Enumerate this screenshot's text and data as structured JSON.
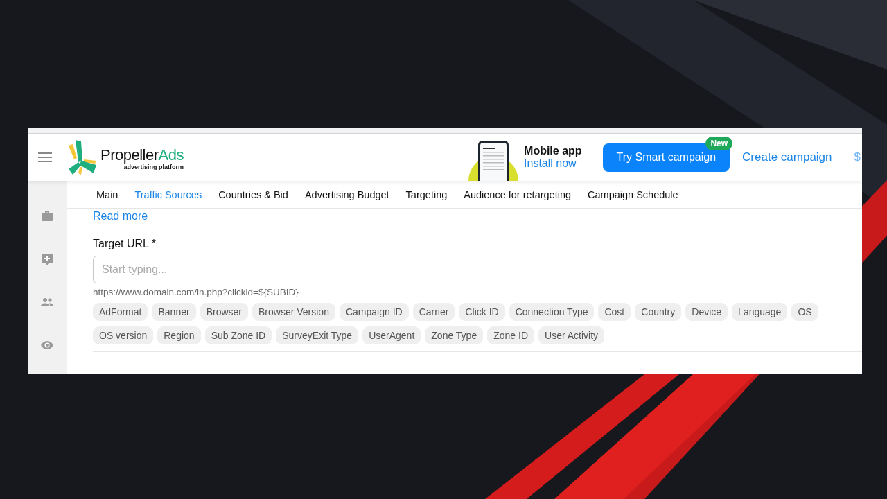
{
  "header": {
    "logo": {
      "name": "Propeller",
      "accent": "Ads",
      "tagline": "advertising platform"
    },
    "promo": {
      "title": "Mobile app",
      "link": "Install now"
    },
    "smart_button": {
      "label": "Try Smart campaign",
      "badge": "New"
    },
    "create_link": "Create campaign",
    "balance_partial": "$"
  },
  "tabs": [
    {
      "label": "Main",
      "selected": false
    },
    {
      "label": "Traffic Sources",
      "selected": true
    },
    {
      "label": "Countries & Bid",
      "selected": false
    },
    {
      "label": "Advertising Budget",
      "selected": false
    },
    {
      "label": "Targeting",
      "selected": false
    },
    {
      "label": "Audience for retargeting",
      "selected": false
    },
    {
      "label": "Campaign Schedule",
      "selected": false
    }
  ],
  "read_more": "Read more",
  "target_url": {
    "label": "Target URL *",
    "placeholder": "Start typing...",
    "hint": "https://www.domain.com/in.php?clickid=${SUBID}"
  },
  "macros": [
    "AdFormat",
    "Banner",
    "Browser",
    "Browser Version",
    "Campaign ID",
    "Carrier",
    "Click ID",
    "Connection Type",
    "Cost",
    "Country",
    "Device",
    "Language",
    "OS",
    "OS version",
    "Region",
    "Sub Zone ID",
    "SurveyExit Type",
    "UserAgent",
    "Zone Type",
    "Zone ID",
    "User Activity"
  ]
}
